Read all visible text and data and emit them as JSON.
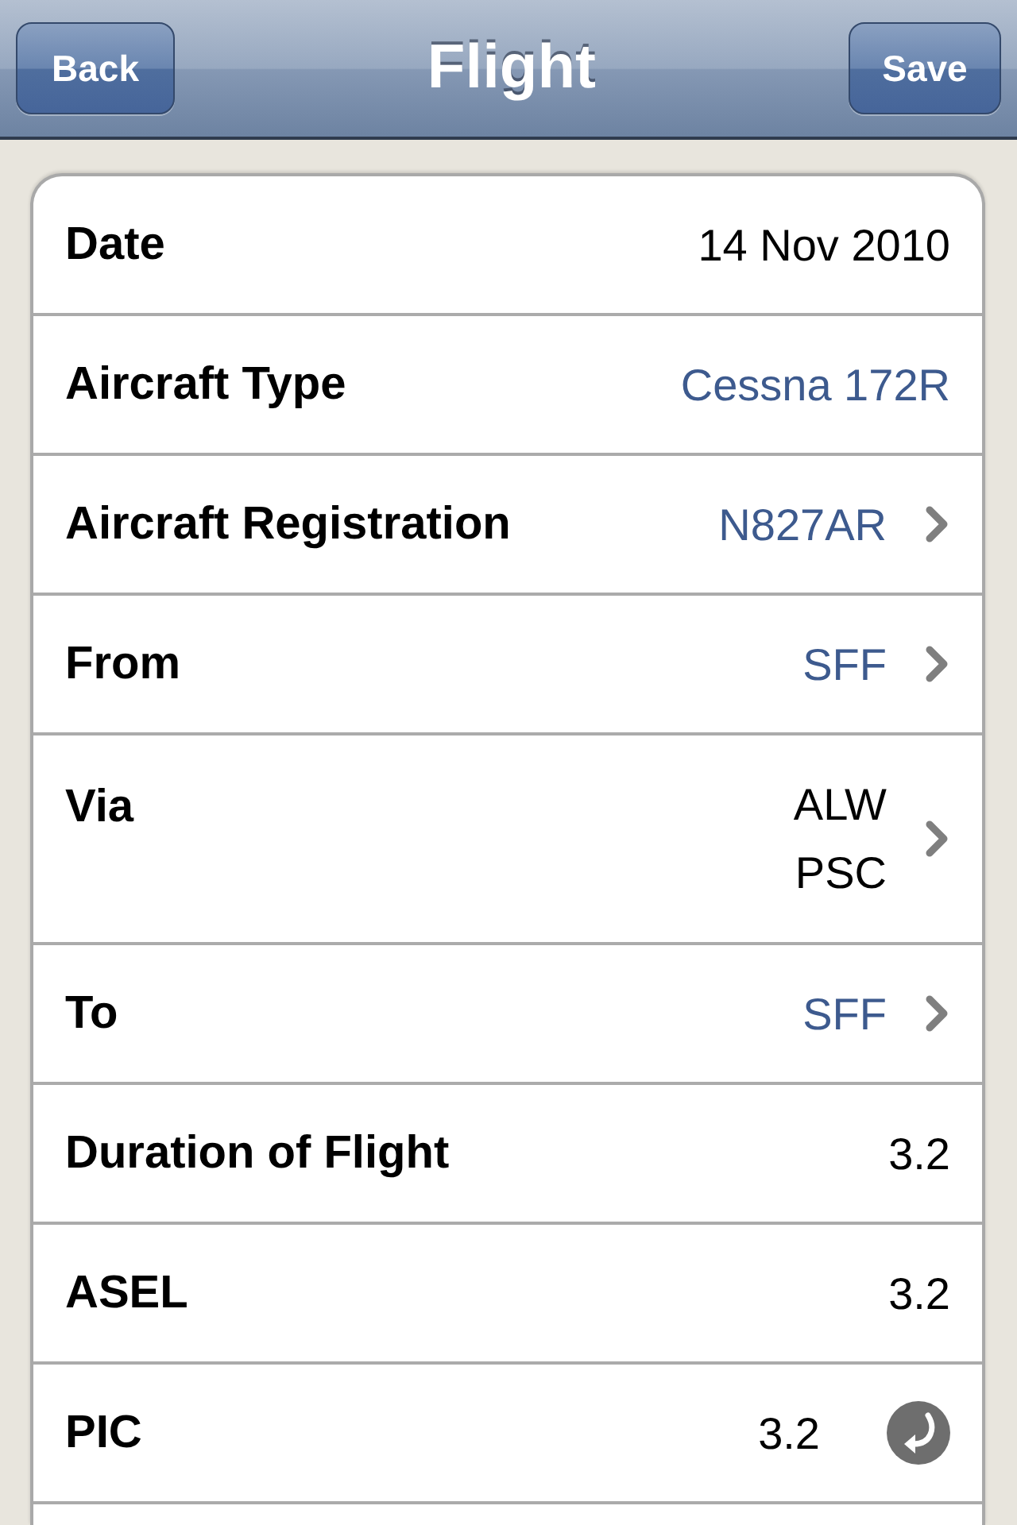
{
  "nav_bar": {
    "back_button": "Back",
    "title": "Flight",
    "save_button": "Save"
  },
  "rows": [
    {
      "label": "Date",
      "value": "14 Nov 2010",
      "kind": "plain"
    },
    {
      "label": "Aircraft Type",
      "value": "Cessna 172R",
      "kind": "link"
    },
    {
      "label": "Aircraft Registration",
      "value": "N827AR",
      "kind": "link",
      "chevron": true
    },
    {
      "label": "From",
      "value": "SFF",
      "kind": "link",
      "chevron": true
    },
    {
      "label": "Via",
      "values": [
        "ALW",
        "PSC"
      ],
      "kind": "plain",
      "chevron": true
    },
    {
      "label": "To",
      "value": "SFF",
      "kind": "link",
      "chevron": true
    },
    {
      "label": "Duration of Flight",
      "value": "3.2",
      "kind": "plain"
    },
    {
      "label": "ASEL",
      "value": "3.2",
      "kind": "plain"
    },
    {
      "label": "PIC",
      "value": "3.2",
      "kind": "plain",
      "reset_button": true
    }
  ]
}
